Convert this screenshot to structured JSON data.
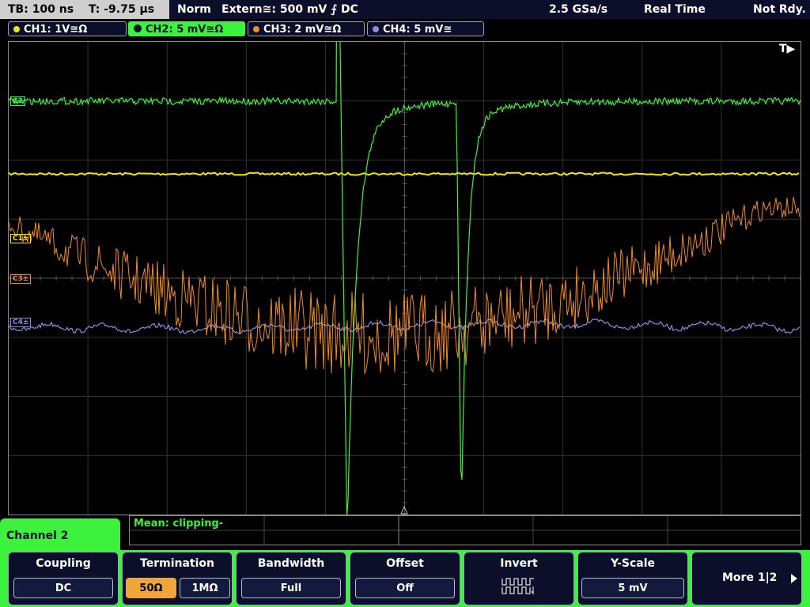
{
  "status": {
    "timebase": "TB: 100 ns",
    "trigger_time": "T: -9.75 µs",
    "mode": "Norm",
    "trigger": "Extern≅: 500 mV ⨍ DC",
    "sample_rate": "2.5 GSa/s",
    "acquisition": "Real Time",
    "state": "Not Rdy."
  },
  "channels": [
    {
      "label": "CH1: 1V≅Ω",
      "color": "#f5e60a",
      "marker": "C1±"
    },
    {
      "label": "CH2: 5 mV≅Ω",
      "color": "#3cf23c",
      "marker": "C2"
    },
    {
      "label": "CH3: 2 mV≅Ω",
      "color": "#f08a2a",
      "marker": "C3±"
    },
    {
      "label": "CH4: 5 mV≅",
      "color": "#8a8ae6",
      "marker": "C4±"
    }
  ],
  "trigger_marker": "T▶",
  "measure": {
    "text": "Mean: clipping-"
  },
  "menu": {
    "channel": "Channel 2",
    "coupling": {
      "title": "Coupling",
      "value": "DC"
    },
    "termination": {
      "title": "Termination",
      "opt1": "50Ω",
      "opt2": "1MΩ"
    },
    "bandwidth": {
      "title": "Bandwidth",
      "value": "Full"
    },
    "offset": {
      "title": "Offset",
      "value": "Off"
    },
    "invert": {
      "title": "Invert"
    },
    "yscale": {
      "title": "Y-Scale",
      "value": "5 mV"
    },
    "more": {
      "label": "More 1|2"
    }
  },
  "colors": {
    "background": "#000000",
    "grid": "#3a3a3a",
    "menu_accent": "#3cf23c",
    "selected": "#f0a43c"
  }
}
